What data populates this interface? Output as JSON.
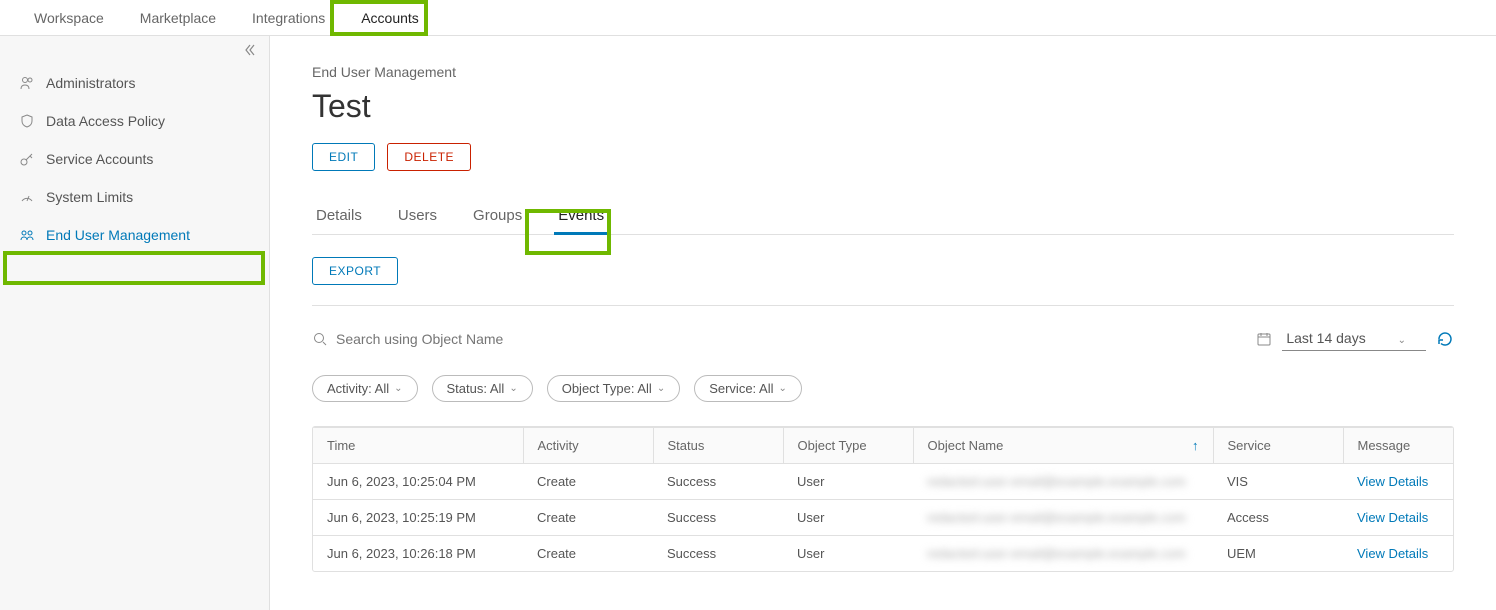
{
  "topnav": {
    "items": [
      "Workspace",
      "Marketplace",
      "Integrations",
      "Accounts"
    ],
    "active": 3
  },
  "sidebar": {
    "items": [
      {
        "icon": "users-icon",
        "label": "Administrators"
      },
      {
        "icon": "shield-icon",
        "label": "Data Access Policy"
      },
      {
        "icon": "key-icon",
        "label": "Service Accounts"
      },
      {
        "icon": "gauge-icon",
        "label": "System Limits"
      },
      {
        "icon": "group-icon",
        "label": "End User Management"
      }
    ],
    "active": 4
  },
  "breadcrumb": "End User Management",
  "page_title": "Test",
  "buttons": {
    "edit": "EDIT",
    "delete": "DELETE",
    "export": "EXPORT"
  },
  "tabs": {
    "items": [
      "Details",
      "Users",
      "Groups",
      "Events"
    ],
    "active": 3
  },
  "search": {
    "placeholder": "Search using Object Name"
  },
  "date_range": {
    "label": "Last 14 days"
  },
  "filters": [
    {
      "label": "Activity: All"
    },
    {
      "label": "Status: All"
    },
    {
      "label": "Object Type: All"
    },
    {
      "label": "Service: All"
    }
  ],
  "table": {
    "columns": [
      "Time",
      "Activity",
      "Status",
      "Object Type",
      "Object Name",
      "Service",
      "Message"
    ],
    "sort_col": 4,
    "view_details": "View Details",
    "rows": [
      {
        "time": "Jun 6, 2023, 10:25:04 PM",
        "activity": "Create",
        "status": "Success",
        "object_type": "User",
        "object_name": "redacted-user-email@example.example.com",
        "service": "VIS"
      },
      {
        "time": "Jun 6, 2023, 10:25:19 PM",
        "activity": "Create",
        "status": "Success",
        "object_type": "User",
        "object_name": "redacted-user-email@example.example.com",
        "service": "Access"
      },
      {
        "time": "Jun 6, 2023, 10:26:18 PM",
        "activity": "Create",
        "status": "Success",
        "object_type": "User",
        "object_name": "redacted-user-email@example.example.com",
        "service": "UEM"
      }
    ]
  }
}
